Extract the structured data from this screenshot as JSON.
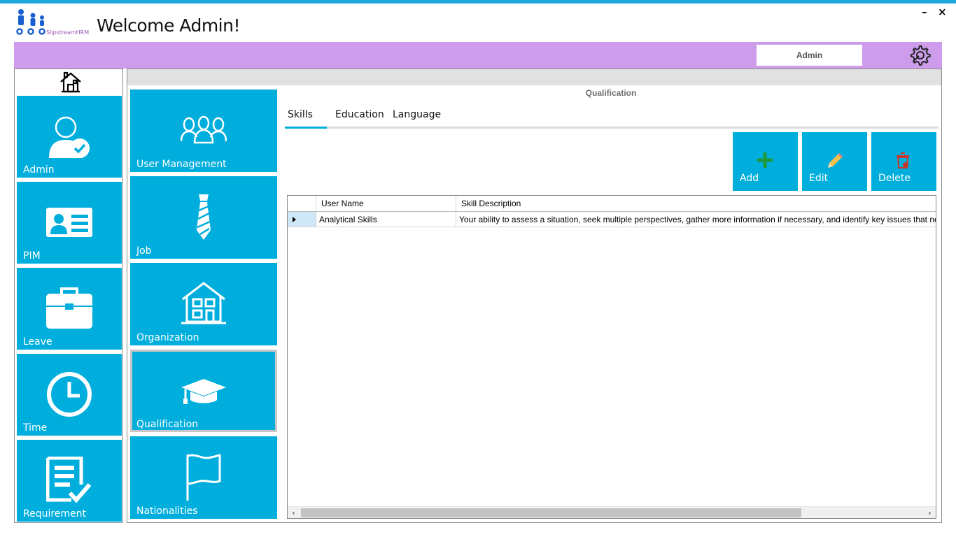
{
  "window": {
    "minimize_label": "–",
    "close_label": "×"
  },
  "header": {
    "logo_text": "SlipstreamHRM",
    "welcome": "Welcome Admin!",
    "user_box": "Admin",
    "settings_icon": "gear-wrench-icon"
  },
  "left_nav": {
    "home_icon": "house-icon",
    "items": [
      {
        "label": "Admin",
        "icon": "user-check-icon"
      },
      {
        "label": "PIM",
        "icon": "id-card-icon"
      },
      {
        "label": "Leave",
        "icon": "briefcase-icon"
      },
      {
        "label": "Time",
        "icon": "clock-icon"
      },
      {
        "label": "Requirement",
        "icon": "checklist-icon"
      }
    ]
  },
  "admin_nav": {
    "items": [
      {
        "label": "User Management",
        "icon": "users-group-icon"
      },
      {
        "label": "Job",
        "icon": "tie-icon"
      },
      {
        "label": "Organization",
        "icon": "building-icon"
      },
      {
        "label": "Qualification",
        "icon": "graduation-cap-icon",
        "selected": true
      },
      {
        "label": "Nationalities",
        "icon": "flag-icon"
      }
    ]
  },
  "main": {
    "title": "Qualification",
    "tabs": [
      {
        "label": "Skills",
        "active": true
      },
      {
        "label": "Education",
        "active": false
      },
      {
        "label": "Language",
        "active": false
      }
    ],
    "actions": {
      "add": "Add",
      "edit": "Edit",
      "delete": "Delete"
    },
    "table": {
      "columns": [
        "User Name",
        "Skill Description"
      ],
      "rows": [
        {
          "user_name": "Analytical Skills",
          "skill_description": "Your ability to assess a situation, seek multiple perspectives, gather more information if necessary, and identify key issues that need to be addressed"
        }
      ]
    },
    "scroll_left": "‹",
    "scroll_right": "›"
  },
  "colors": {
    "accent": "#00aedd",
    "header_bar": "#cd9deb",
    "top_line": "#1ea7d9"
  }
}
